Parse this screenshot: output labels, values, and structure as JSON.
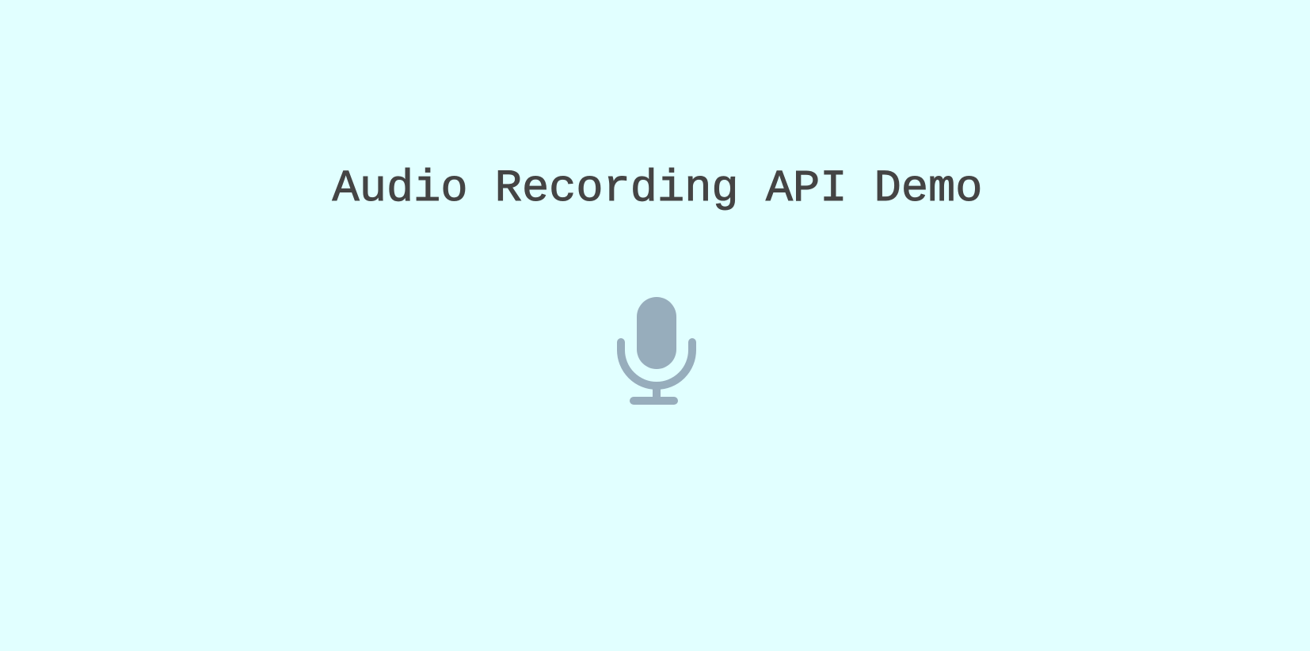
{
  "page": {
    "title": "Audio Recording API Demo",
    "background_color": "#e1ffff",
    "title_color": "#444444"
  },
  "recorder": {
    "icon": "microphone-icon",
    "icon_color": "#97adbc"
  }
}
